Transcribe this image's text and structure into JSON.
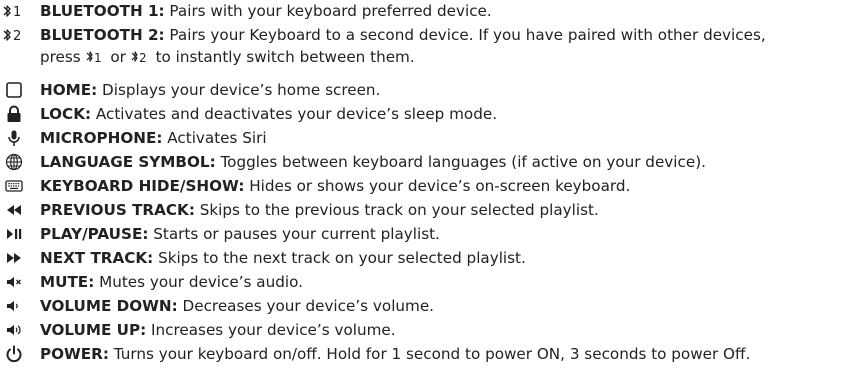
{
  "items": [
    {
      "icon": "bluetooth-1-icon",
      "icon_label": "'1",
      "term": "BLUETOOTH 1",
      "sep": ":",
      "desc": " Pairs with your keyboard preferred device."
    },
    {
      "icon": "bluetooth-2-icon",
      "icon_label": "'2",
      "term": "BLUETOOTH 2",
      "sep": ":",
      "desc": " Pairs your Keyboard to a second device. If you have paired with other devices,",
      "cont_a": "press ",
      "cont_bt1": "'1",
      "cont_mid": " or ",
      "cont_bt2": "'2",
      "cont_b": " to instantly switch between them."
    },
    {
      "icon": "home-icon",
      "term": "HOME",
      "sep": ":",
      "desc": " Displays your device’s home screen."
    },
    {
      "icon": "lock-icon",
      "term": "LOCK:",
      "sep": "",
      "desc": " Activates and deactivates your device’s sleep mode."
    },
    {
      "icon": "microphone-icon",
      "term": "MICROPHONE:",
      "sep": "",
      "desc": " Activates Siri"
    },
    {
      "icon": "globe-icon",
      "term": "LANGUAGE SYMBOL",
      "sep": ":",
      "desc": " Toggles between keyboard languages (if active on your device)."
    },
    {
      "icon": "keyboard-icon",
      "term": "KEYBOARD HIDE/SHOW",
      "sep": ":",
      "desc": " Hides or shows your device’s on-screen keyboard."
    },
    {
      "icon": "previous-track-icon",
      "term": "PREVIOUS TRACK",
      "sep": ":",
      "desc": " Skips to the previous track on your selected playlist."
    },
    {
      "icon": "play-pause-icon",
      "term": "PLAY/PAUSE",
      "sep": ":",
      "desc": " Starts or pauses your current playlist."
    },
    {
      "icon": "next-track-icon",
      "term": "NEXT TRACK",
      "sep": ":",
      "desc": " Skips to the next track on your selected playlist."
    },
    {
      "icon": "mute-icon",
      "term": "MUTE",
      "sep": ":",
      "desc": " Mutes your device’s audio."
    },
    {
      "icon": "volume-down-icon",
      "term": "VOLUME DOWN",
      "sep": ":",
      "desc": " Decreases your device’s volume."
    },
    {
      "icon": "volume-up-icon",
      "term": "VOLUME UP",
      "sep": ":",
      "desc": " Increases your device’s volume."
    },
    {
      "icon": "power-icon",
      "term": "POWER",
      "sep": ":",
      "desc": " Turns your keyboard on/off. Hold for 1 second to power ON, 3 seconds to power Off."
    }
  ]
}
